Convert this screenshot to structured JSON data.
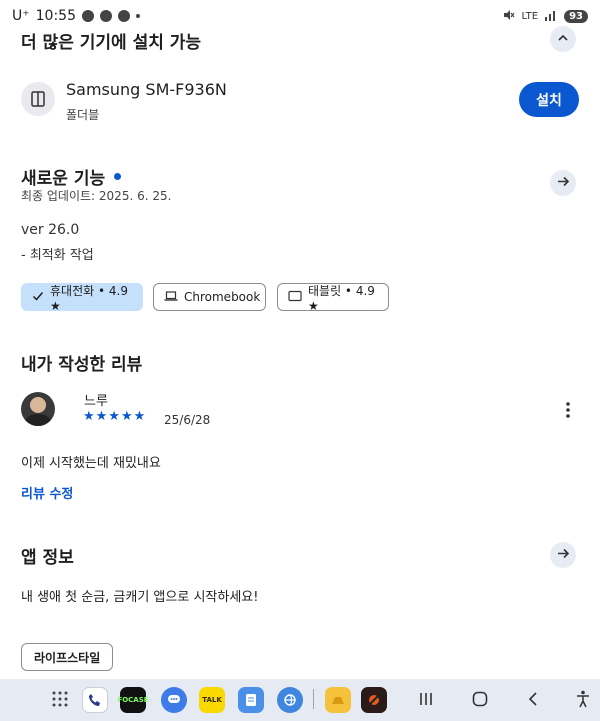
{
  "status_bar": {
    "carrier": "U⁺",
    "time": "10:55",
    "network": "LTE",
    "battery": "93"
  },
  "devices_section": {
    "title": "더 많은 기기에 설치 가능",
    "device_name": "Samsung SM-F936N",
    "device_type": "폴더블",
    "install_label": "설치"
  },
  "whats_new": {
    "title": "새로운 기능",
    "updated": "최종 업데이트: 2025. 6. 25.",
    "version": "ver 26.0",
    "notes": "- 최적화 작업"
  },
  "device_chips": [
    {
      "label": "휴대전화 • 4.9 ★",
      "selected": true
    },
    {
      "label": "Chromebook",
      "selected": false
    },
    {
      "label": "태블릿 • 4.9 ★",
      "selected": false
    }
  ],
  "review_section": {
    "title": "내가 작성한 리뷰",
    "reviewer": "느루",
    "rating": 5,
    "stars": "★★★★★",
    "date": "25/6/28",
    "text": "이제 시작했는데 재밌내요",
    "edit_label": "리뷰 수정"
  },
  "app_info": {
    "title": "앱 정보",
    "description": "내 생애 첫 순금, 금캐기 앱으로 시작하세요!",
    "tag": "라이프스타일"
  },
  "nav_bar": {
    "focase_label": "FOCASE",
    "talk_label": "TALK"
  },
  "colors": {
    "accent": "#0b57d0",
    "chip_selected": "#c5e0fa",
    "nav_background": "#e6ebf3"
  }
}
